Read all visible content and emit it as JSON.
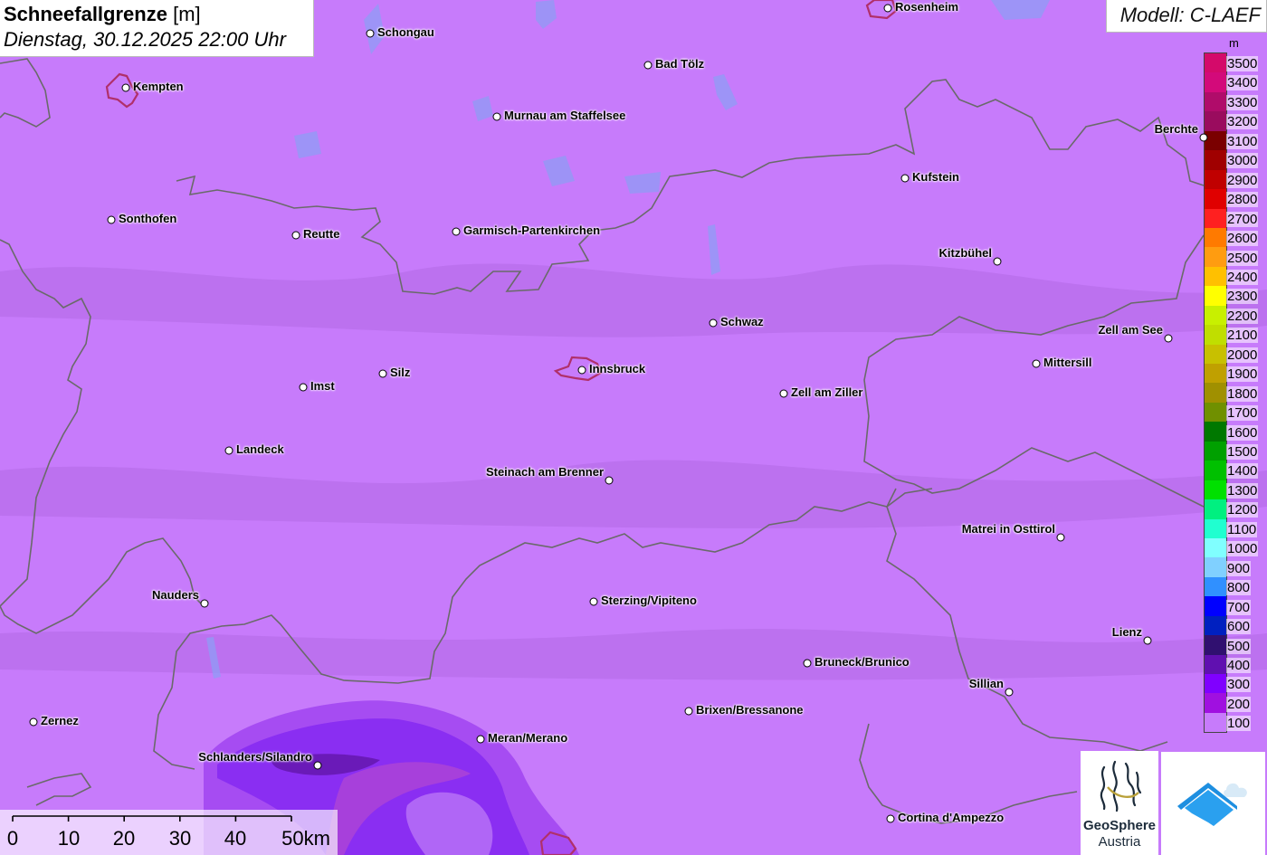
{
  "title": {
    "main": "Schneefallgrenze",
    "unit": "[m]",
    "datetime": "Dienstag, 30.12.2025 22:00 Uhr"
  },
  "model": "Modell: C-LAEF",
  "legend": {
    "unit": "m",
    "entries": [
      {
        "value": "3500",
        "color": "#d40a6a"
      },
      {
        "value": "3400",
        "color": "#d30a7a"
      },
      {
        "value": "3300",
        "color": "#b00c6a"
      },
      {
        "value": "3200",
        "color": "#9a0c5e"
      },
      {
        "value": "3100",
        "color": "#7a0000"
      },
      {
        "value": "3000",
        "color": "#a00000"
      },
      {
        "value": "2900",
        "color": "#c00000"
      },
      {
        "value": "2800",
        "color": "#e00000"
      },
      {
        "value": "2700",
        "color": "#ff2020"
      },
      {
        "value": "2600",
        "color": "#ff7a00"
      },
      {
        "value": "2500",
        "color": "#ff9c10"
      },
      {
        "value": "2400",
        "color": "#ffc000"
      },
      {
        "value": "2300",
        "color": "#ffff00"
      },
      {
        "value": "2200",
        "color": "#c8f000"
      },
      {
        "value": "2100",
        "color": "#c0de00"
      },
      {
        "value": "2000",
        "color": "#c8c000"
      },
      {
        "value": "1900",
        "color": "#c0a000"
      },
      {
        "value": "1800",
        "color": "#a09000"
      },
      {
        "value": "1700",
        "color": "#709000"
      },
      {
        "value": "1600",
        "color": "#007800"
      },
      {
        "value": "1500",
        "color": "#00a000"
      },
      {
        "value": "1400",
        "color": "#00c000"
      },
      {
        "value": "1300",
        "color": "#00e000"
      },
      {
        "value": "1200",
        "color": "#00f080"
      },
      {
        "value": "1100",
        "color": "#20ffd0"
      },
      {
        "value": "1000",
        "color": "#80ffff"
      },
      {
        "value": "900",
        "color": "#80d0ff"
      },
      {
        "value": "800",
        "color": "#3090ff"
      },
      {
        "value": "700",
        "color": "#0000ff"
      },
      {
        "value": "600",
        "color": "#0020c0"
      },
      {
        "value": "500",
        "color": "#301070"
      },
      {
        "value": "400",
        "color": "#6010b0"
      },
      {
        "value": "300",
        "color": "#8000ff"
      },
      {
        "value": "200",
        "color": "#a010e0"
      },
      {
        "value": "100",
        "color": "#c77bfb"
      }
    ]
  },
  "cities": [
    {
      "name": "Rosenheim",
      "side": "right"
    },
    {
      "name": "Schongau",
      "side": "right"
    },
    {
      "name": "Bad Tölz",
      "side": "right"
    },
    {
      "name": "Kempten",
      "side": "right"
    },
    {
      "name": "Murnau am Staffelsee",
      "side": "right"
    },
    {
      "name": "Berchte",
      "side": "left"
    },
    {
      "name": "Kufstein",
      "side": "right"
    },
    {
      "name": "Sonthofen",
      "side": "right"
    },
    {
      "name": "Reutte",
      "side": "right"
    },
    {
      "name": "Garmisch-Partenkirchen",
      "side": "right"
    },
    {
      "name": "Kitzbühel",
      "side": "left"
    },
    {
      "name": "Schwaz",
      "side": "right"
    },
    {
      "name": "Zell am See",
      "side": "left"
    },
    {
      "name": "Mittersill",
      "side": "right"
    },
    {
      "name": "Innsbruck",
      "side": "right"
    },
    {
      "name": "Silz",
      "side": "right"
    },
    {
      "name": "Imst",
      "side": "right"
    },
    {
      "name": "Zell am Ziller",
      "side": "right"
    },
    {
      "name": "Landeck",
      "side": "right"
    },
    {
      "name": "Steinach am Brenner",
      "side": "left"
    },
    {
      "name": "Matrei in Osttirol",
      "side": "left"
    },
    {
      "name": "Nauders",
      "side": "left"
    },
    {
      "name": "Sterzing/Vipiteno",
      "side": "right"
    },
    {
      "name": "Lienz",
      "side": "left"
    },
    {
      "name": "Bruneck/Brunico",
      "side": "right"
    },
    {
      "name": "Sillian",
      "side": "left"
    },
    {
      "name": "Brixen/Bressanone",
      "side": "right"
    },
    {
      "name": "Zernez",
      "side": "right"
    },
    {
      "name": "Meran/Merano",
      "side": "right"
    },
    {
      "name": "Schlanders/Silandro",
      "side": "left"
    },
    {
      "name": "Cortina d'Ampezzo",
      "side": "right"
    }
  ],
  "scale": {
    "labels": [
      "0",
      "10",
      "20",
      "30",
      "40",
      "50km"
    ]
  },
  "logos": {
    "geosphere_name": "GeoSphere",
    "geosphere_sub": "Austria"
  },
  "colors": {
    "background": "#c77bfb",
    "band_200": "#a64cf2",
    "band_300": "#8a2ef2",
    "band_400": "#6a1ab8",
    "border": "#6a6a6a",
    "city_outline": "#b0306a"
  }
}
